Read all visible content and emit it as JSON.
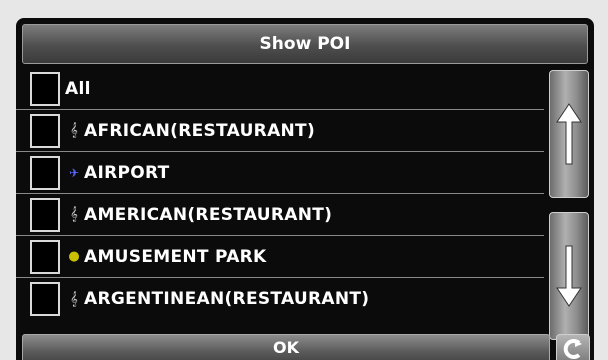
{
  "header": {
    "title": "Show POI"
  },
  "items": [
    {
      "label": "All",
      "icon": "",
      "checked": false
    },
    {
      "label": "AFRICAN(RESTAURANT)",
      "icon": "fork-knife-icon",
      "checked": false
    },
    {
      "label": "AIRPORT",
      "icon": "airplane-icon",
      "checked": false
    },
    {
      "label": "AMERICAN(RESTAURANT)",
      "icon": "fork-knife-icon",
      "checked": false
    },
    {
      "label": "AMUSEMENT PARK",
      "icon": "amusement-park-icon",
      "checked": false
    },
    {
      "label": "ARGENTINEAN(RESTAURANT)",
      "icon": "fork-knife-icon",
      "checked": false
    }
  ],
  "scroll": {
    "up_icon": "arrow-up-icon",
    "down_icon": "arrow-down-icon"
  },
  "footer": {
    "ok_label": "OK",
    "back_icon": "back-icon"
  },
  "colors": {
    "background": "#0b0b0b",
    "text": "#ffffff",
    "airport_icon": "#5a6cff",
    "park_icon": "#c8c000"
  }
}
